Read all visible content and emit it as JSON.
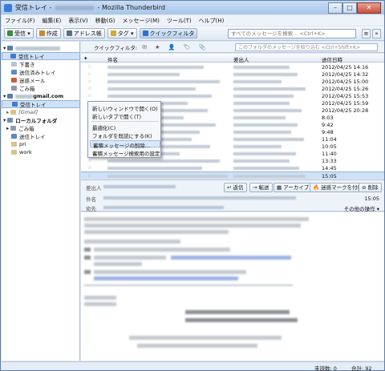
{
  "window": {
    "title_prefix": "受信トレイ - ",
    "title_suffix": " - Mozilla Thunderbird",
    "minimize": "–",
    "maximize": "□",
    "close": "✕"
  },
  "menu": [
    "ファイル(F)",
    "編集(E)",
    "表示(V)",
    "移動(G)",
    "メッセージ(M)",
    "ツール(T)",
    "ヘルプ(H)"
  ],
  "toolbar": {
    "receive": "受信",
    "compose": "作成",
    "address_book": "アドレス帳",
    "tag": "タグ",
    "quick_filter": "クイックフィルタ",
    "search_placeholder": "すべてのメッセージを検索...   <Ctrl+K>"
  },
  "folders": {
    "account1": [
      {
        "label": "受信トレイ",
        "selected": true
      },
      {
        "label": "下書き"
      },
      {
        "label": "送信済みトレイ"
      },
      {
        "label": "迷惑メール"
      },
      {
        "label": "ごみ箱"
      }
    ],
    "account2_suffix": "gmail.com",
    "account2_items": [
      {
        "label": "受信トレイ",
        "selected": true
      },
      {
        "label": "[Gmail]"
      }
    ],
    "local": "ローカルフォルダ",
    "local_items": [
      "ごみ箱",
      "送信トレイ",
      "pri",
      "work"
    ]
  },
  "quick_filter": {
    "label": "クイックフィルタ:",
    "icons": "✉ ★ 👤 🏷 📎",
    "search_placeholder": "このフォルダのメッセージを絞り込む <Ctrl+Shift+K>"
  },
  "thread_columns": {
    "subject": "件名",
    "sender": "差出人",
    "date": "送信日時"
  },
  "threads": [
    {
      "date": "2012/04/25 14:16"
    },
    {
      "date": "2012/04/25 14:32"
    },
    {
      "date": "2012/04/25 15:00"
    },
    {
      "date": "2012/04/25 15:26"
    },
    {
      "date": "2012/04/25 15:53"
    },
    {
      "date": "2012/04/25 15:59"
    },
    {
      "date": "2012/04/25 20:28"
    },
    {
      "date": "8:03"
    },
    {
      "date": "9:42"
    },
    {
      "date": "9:48"
    },
    {
      "date": "11:04"
    },
    {
      "date": "10:05"
    },
    {
      "date": "11:40"
    },
    {
      "date": "13:33"
    },
    {
      "date": "14:45"
    },
    {
      "date": "15:05",
      "selected": true
    }
  ],
  "context_menu": {
    "items": [
      {
        "label": "新しいウィンドウで開く(O)"
      },
      {
        "label": "新しいタブで開く(T)"
      },
      {
        "label": "最適化(C)"
      },
      {
        "label": "フォルダを既読にする(K)"
      },
      {
        "label": "蓄積メッセージの削除...",
        "highlight": true
      },
      {
        "label": "蓄積メッセージ検索用の設定"
      }
    ]
  },
  "message_header": {
    "from_label": "差出人",
    "subject_label": "件名",
    "to_label": "宛先",
    "reply": "返信",
    "forward": "転送",
    "archive": "アーカイブ",
    "junk": "迷惑マークを付ける",
    "delete": "削除",
    "time": "15:05",
    "other_actions": "その他の操作 ▾"
  },
  "status": {
    "unread": "未読数: 0",
    "total": "合計: 92"
  },
  "colors": {
    "accent": "#3a7bd5",
    "selection": "#cfe1f6"
  }
}
